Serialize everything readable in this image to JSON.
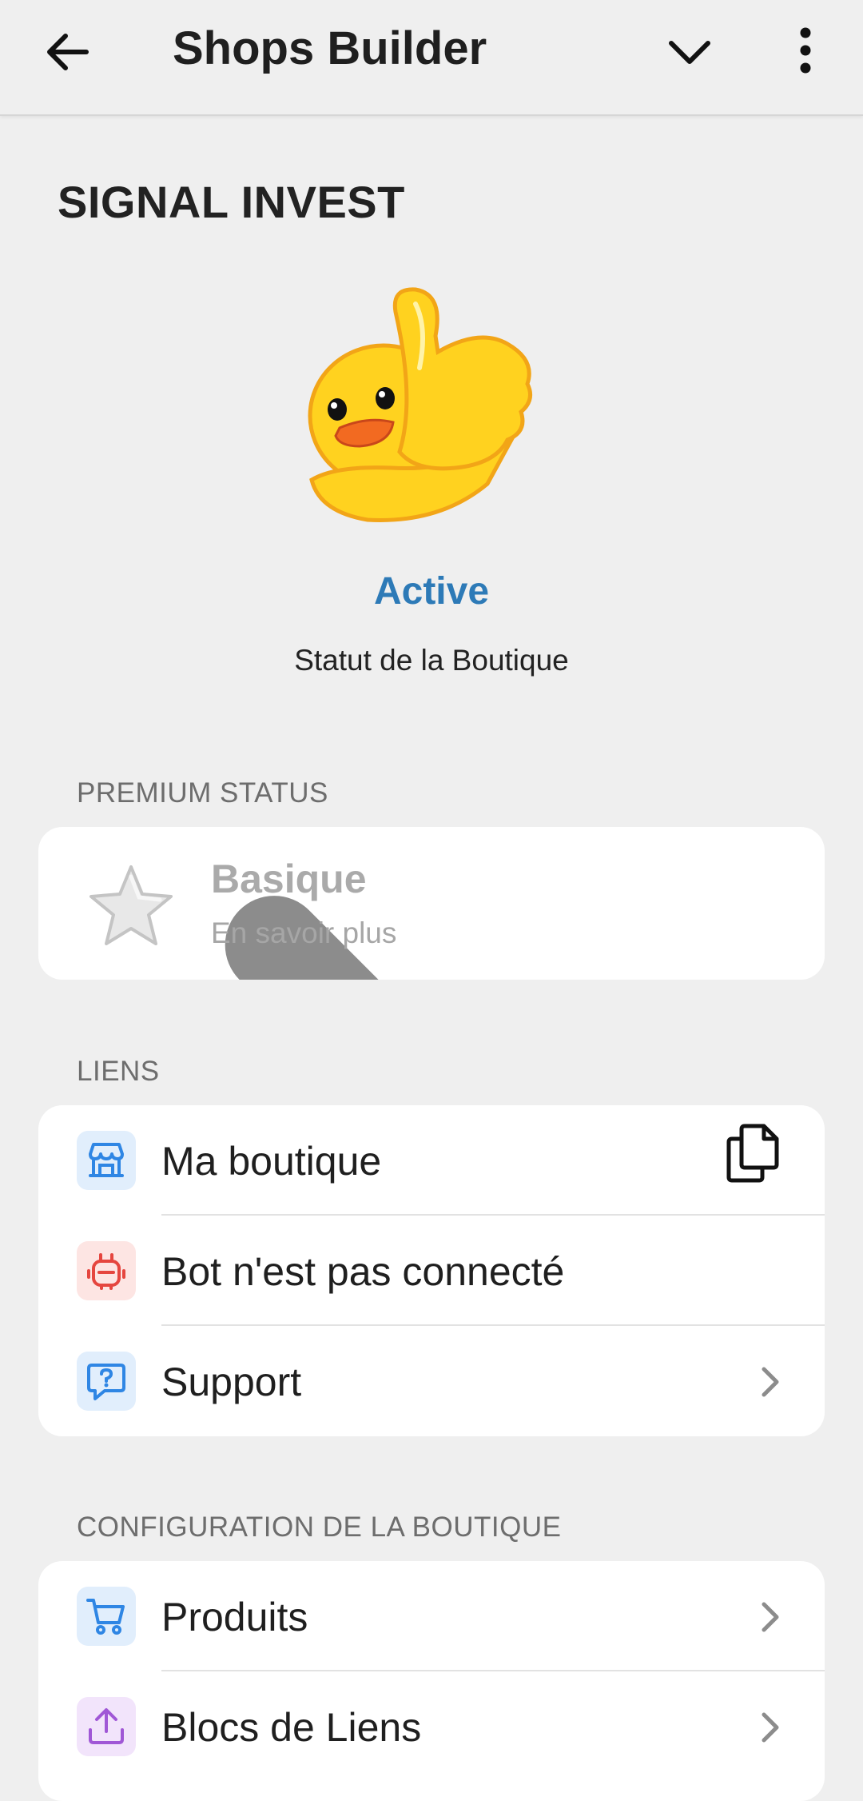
{
  "header": {
    "title": "Shops Builder",
    "back_icon": "back-arrow-icon",
    "dropdown_icon": "chevron-down-icon",
    "menu_icon": "more-vertical-icon"
  },
  "shop": {
    "name": "SIGNAL INVEST",
    "status_value": "Active",
    "status_label": "Statut de la Boutique",
    "status_color": "#2d7ab7"
  },
  "premium": {
    "section_title": "PREMIUM STATUS",
    "plan": "Basique",
    "link": "En savoir plus"
  },
  "links": {
    "section_title": "LIENS",
    "items": [
      {
        "label": "Ma boutique",
        "icon": "store-icon",
        "accent": "#2f86e4",
        "action_icon": "copy-icon"
      },
      {
        "label": "Bot n'est pas connecté",
        "icon": "bot-icon",
        "accent": "#e5463f"
      },
      {
        "label": "Support",
        "icon": "help-chat-icon",
        "accent": "#2f86e4"
      }
    ]
  },
  "config": {
    "section_title": "CONFIGURATION DE LA BOUTIQUE",
    "items": [
      {
        "label": "Produits",
        "icon": "cart-icon",
        "accent": "#2f86e4"
      },
      {
        "label": "Blocs de Liens",
        "icon": "upload-icon",
        "accent": "#a057d6"
      }
    ]
  }
}
